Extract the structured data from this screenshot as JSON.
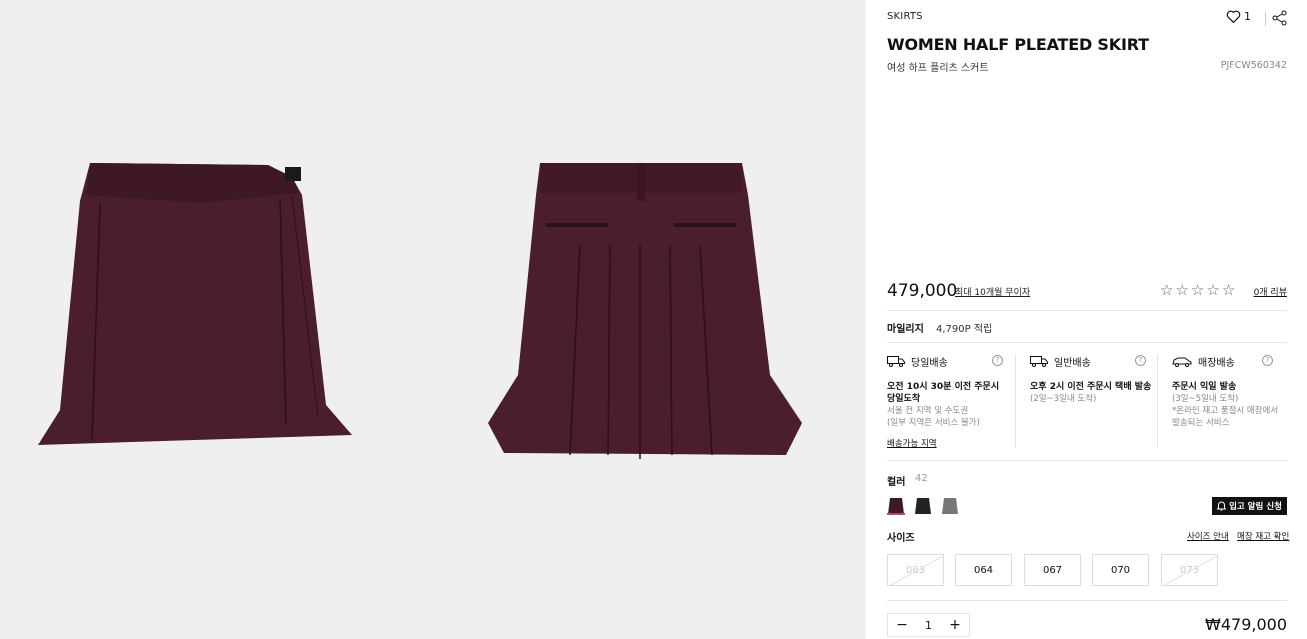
{
  "product": {
    "category": "SKIRTS",
    "likes": "1",
    "title": "WOMEN HALF PLEATED SKIRT",
    "subtitle": "여성 하프 플리츠 스커트",
    "code": "PJFCW560342",
    "price": "479,000",
    "installment": "최대 10개월 무이자",
    "rating_stars": [
      "☆",
      "☆",
      "☆",
      "☆",
      "☆"
    ],
    "reviews": "0개 리뷰",
    "image_color": "#4a1e2c"
  },
  "mileage": {
    "label": "마일리지",
    "value": "4,790P 적립"
  },
  "shipping": [
    {
      "title": "당일배송",
      "bold": "오전 10시 30분 이전 주문시\n당일도착",
      "note": "서울 전 지역 및 수도권\n(일부 지역은 서비스 불가)",
      "link": "배송가능 지역"
    },
    {
      "title": "일반배송",
      "bold": "오후 2시 이전 주문시 택배 발송",
      "note": "(2일~3일내 도착)",
      "link": ""
    },
    {
      "title": "매장배송",
      "bold": "주문시 익일 발송",
      "note": "(3일~5일내 도착)\n*온라인 재고 품절시 매장에서\n발송되는 서비스",
      "link": ""
    }
  ],
  "color": {
    "label": "컬러",
    "count": "42",
    "swatches": [
      "#3d1a26",
      "#222222",
      "#777777"
    ],
    "notify_label": "입고 알림 신청"
  },
  "size": {
    "label": "사이즈",
    "guide": "사이즈 안내",
    "stock_check": "매장 재고 확인",
    "options": [
      {
        "label": "063",
        "soldout": true
      },
      {
        "label": "064",
        "soldout": false
      },
      {
        "label": "067",
        "soldout": false
      },
      {
        "label": "070",
        "soldout": false
      },
      {
        "label": "073",
        "soldout": true
      }
    ]
  },
  "order": {
    "qty_minus": "−",
    "qty": "1",
    "qty_plus": "+",
    "total": "₩479,000"
  }
}
